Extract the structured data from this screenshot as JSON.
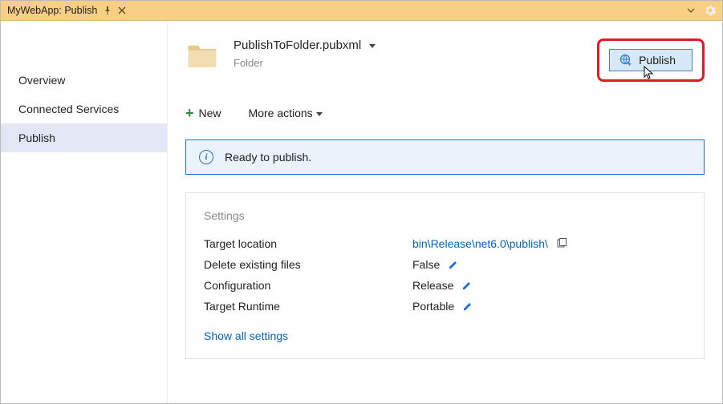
{
  "titlebar": {
    "title": "MyWebApp: Publish"
  },
  "sidebar": {
    "items": [
      {
        "label": "Overview",
        "selected": false
      },
      {
        "label": "Connected Services",
        "selected": false
      },
      {
        "label": "Publish",
        "selected": true
      }
    ]
  },
  "profile": {
    "filename": "PublishToFolder.pubxml",
    "type": "Folder"
  },
  "publish_button": {
    "label": "Publish"
  },
  "actions": {
    "new_label": "New",
    "more_label": "More actions"
  },
  "status": {
    "message": "Ready to publish."
  },
  "settings": {
    "heading": "Settings",
    "rows": [
      {
        "label": "Target location",
        "value": "bin\\Release\\net6.0\\publish\\",
        "is_link": true,
        "has_copy": true,
        "has_edit": false
      },
      {
        "label": "Delete existing files",
        "value": "False",
        "is_link": false,
        "has_copy": false,
        "has_edit": true
      },
      {
        "label": "Configuration",
        "value": "Release",
        "is_link": false,
        "has_copy": false,
        "has_edit": true
      },
      {
        "label": "Target Runtime",
        "value": "Portable",
        "is_link": false,
        "has_copy": false,
        "has_edit": true
      }
    ],
    "show_all_label": "Show all settings"
  }
}
